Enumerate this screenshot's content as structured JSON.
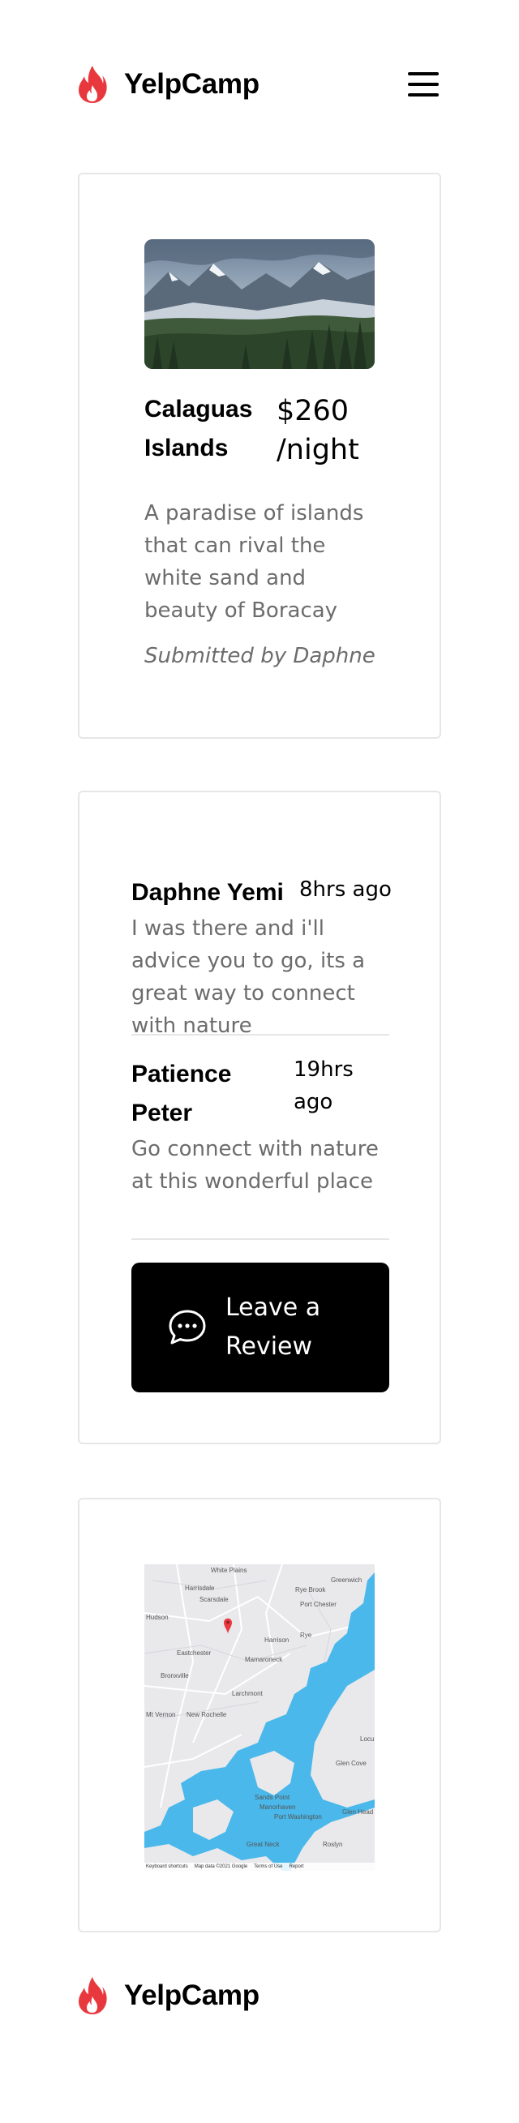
{
  "brand": {
    "name": "YelpCamp",
    "icon": "flame-icon",
    "color": "#e8383d"
  },
  "nav": {
    "menu_icon": "hamburger-menu-icon"
  },
  "campground": {
    "title": "Calaguas Islands",
    "price": "$260 /night",
    "description": "A paradise of islands that can rival the white sand and beauty of Boracay",
    "author": "Submitted by Daphne"
  },
  "reviews": [
    {
      "name": "Daphne Yemi",
      "time": "8hrs ago",
      "text": "I was there and i'll advice you to go, its a great way to connect with nature"
    },
    {
      "name": "Patience Peter",
      "time": "19hrs ago",
      "text": "Go connect with nature at this wonderful place"
    }
  ],
  "leave_review": {
    "label": "Leave a Review",
    "icon": "chat-bubble-icon"
  },
  "map": {
    "water_color": "#4ab8ea",
    "land_color": "#e9e9ec",
    "marker_color": "#e8383d",
    "places": [
      "White Plains",
      "Greenwich",
      "Harrisdale",
      "Rye Brook",
      "Scarsdale",
      "Port Chester",
      "Hudson",
      "Rye",
      "Harrison",
      "Eastchester",
      "Mamaroneck",
      "Bronxville",
      "Larchmont",
      "Mt Vernon",
      "New Rochelle",
      "Glen Cove",
      "Sands Point",
      "Manorhaven",
      "Port Washington",
      "Glen Head",
      "Great Neck",
      "Roslyn",
      "Locu"
    ],
    "attribution": [
      "Keyboard shortcuts",
      "Map data ©2021 Google",
      "Terms of Use",
      "Report"
    ]
  },
  "footer": {
    "brand_name": "YelpCamp"
  }
}
